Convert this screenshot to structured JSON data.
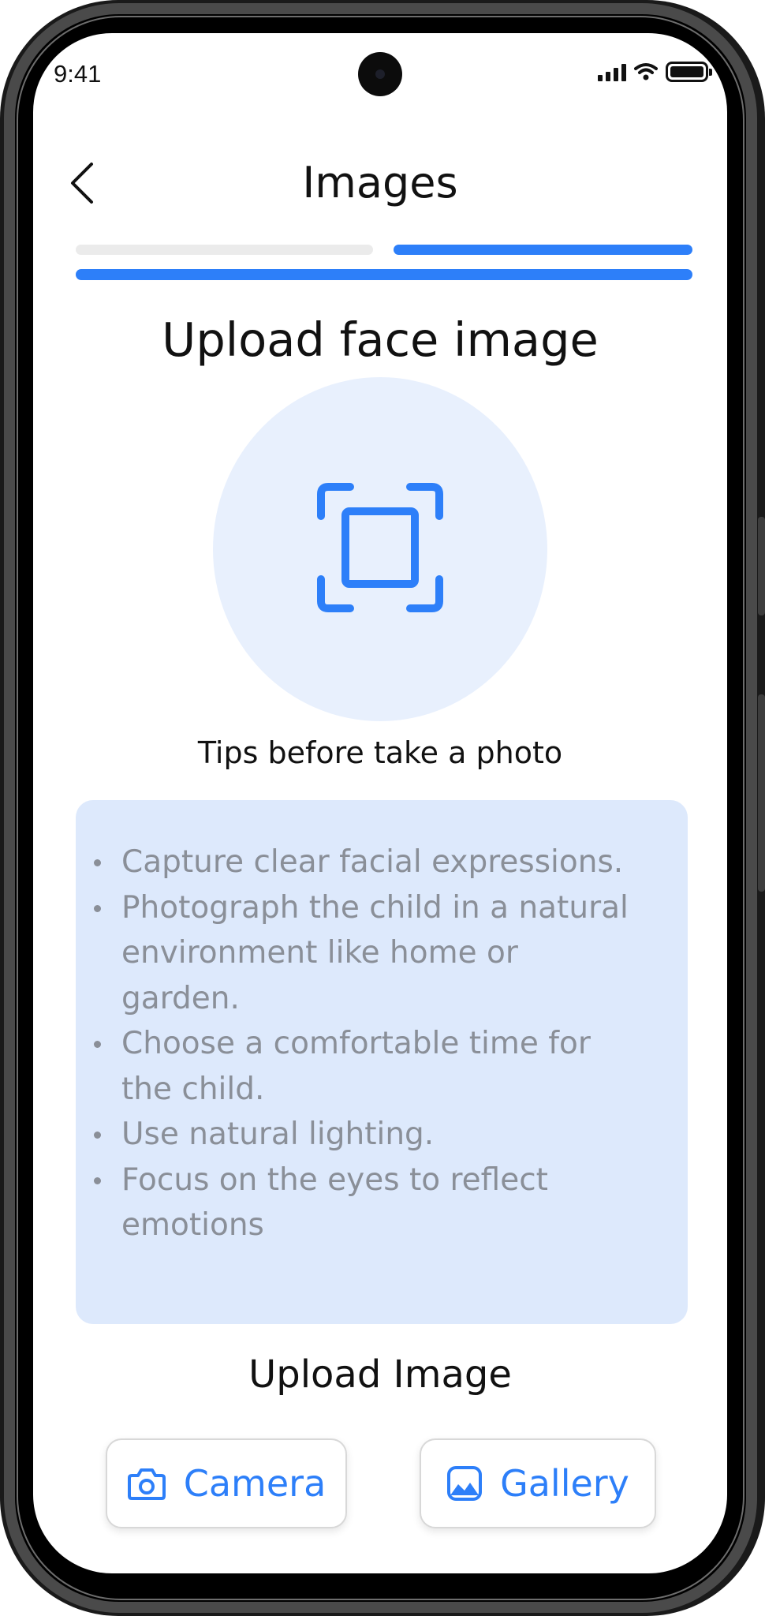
{
  "status_bar": {
    "time": "9:41",
    "icons": [
      "signal-icon",
      "wifi-icon",
      "battery-icon"
    ]
  },
  "header": {
    "back_icon": "chevron-left-icon",
    "title": "Images"
  },
  "progress": {
    "steps_total": 2,
    "current_step": 2,
    "active_color": "#2d7ff9",
    "inactive_color": "#ebebeb"
  },
  "main": {
    "section_title": "Upload face image",
    "face_icon": "face-frame-icon",
    "tips_title": "Tips before take a photo",
    "tips": [
      "Capture clear facial expressions.",
      "Photograph the child in a natural environment like home or garden.",
      "Choose a comfortable time for the child.",
      "Use natural lighting.",
      "Focus on the eyes to reflect emotions"
    ]
  },
  "upload": {
    "label": "Upload Image",
    "camera": {
      "label": "Camera",
      "icon": "camera-icon"
    },
    "gallery": {
      "label": "Gallery",
      "icon": "gallery-icon"
    }
  },
  "colors": {
    "accent": "#2d7ff9",
    "tips_background": "#dde9fc",
    "face_circle": "#e8f0fd",
    "tips_text": "#8a8f98"
  }
}
